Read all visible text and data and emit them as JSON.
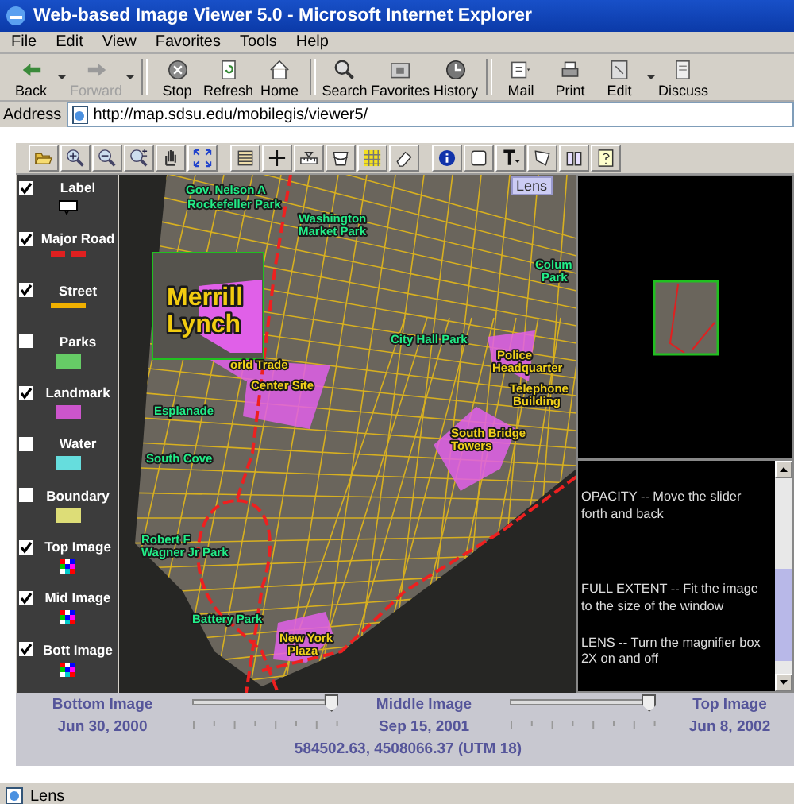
{
  "window": {
    "title": "Web-based Image Viewer 5.0 - Microsoft Internet Explorer"
  },
  "menu": [
    "File",
    "Edit",
    "View",
    "Favorites",
    "Tools",
    "Help"
  ],
  "toolbar": [
    {
      "label": "Back",
      "kind": "back",
      "disabled": false,
      "dropdown": true
    },
    {
      "label": "Forward",
      "kind": "forward",
      "disabled": true,
      "dropdown": true
    },
    {
      "label": "Stop",
      "kind": "stop",
      "disabled": false,
      "dropdown": false
    },
    {
      "label": "Refresh",
      "kind": "refresh",
      "disabled": false,
      "dropdown": false
    },
    {
      "label": "Home",
      "kind": "home",
      "disabled": false,
      "dropdown": false
    },
    {
      "label": "Search",
      "kind": "search",
      "disabled": false,
      "dropdown": false
    },
    {
      "label": "Favorites",
      "kind": "favorites",
      "disabled": false,
      "dropdown": false
    },
    {
      "label": "History",
      "kind": "history",
      "disabled": false,
      "dropdown": false
    },
    {
      "label": "Mail",
      "kind": "mail",
      "disabled": false,
      "dropdown": false
    },
    {
      "label": "Print",
      "kind": "print",
      "disabled": false,
      "dropdown": false
    },
    {
      "label": "Edit",
      "kind": "edit",
      "disabled": false,
      "dropdown": true
    },
    {
      "label": "Discuss",
      "kind": "discuss",
      "disabled": false,
      "dropdown": false
    }
  ],
  "address": {
    "label": "Address",
    "value": "http://map.sdsu.edu/mobilegis/viewer5/"
  },
  "legend": [
    {
      "label": "Label",
      "checked": true,
      "kind": "label"
    },
    {
      "label": "Major Road",
      "checked": true,
      "kind": "dash"
    },
    {
      "label": "Street",
      "checked": true,
      "kind": "line"
    },
    {
      "label": "Parks",
      "checked": false,
      "kind": "swatch",
      "color": "#66cc66"
    },
    {
      "label": "Landmark",
      "checked": true,
      "kind": "swatch",
      "color": "#cc55cc"
    },
    {
      "label": "Water",
      "checked": false,
      "kind": "swatch",
      "color": "#66dddd"
    },
    {
      "label": "Boundary",
      "checked": false,
      "kind": "swatch",
      "color": "#dddd77"
    },
    {
      "label": "Top Image",
      "checked": true,
      "kind": "image"
    },
    {
      "label": "Mid Image",
      "checked": true,
      "kind": "image"
    },
    {
      "label": "Bott Image",
      "checked": true,
      "kind": "image"
    }
  ],
  "map": {
    "lens_button": "Lens",
    "labels": [
      {
        "kind": "park",
        "lines": [
          "Gov. Nelson A",
          "Rockefeller Park"
        ]
      },
      {
        "kind": "park",
        "lines": [
          "Washington",
          "Market Park"
        ]
      },
      {
        "kind": "featured",
        "lines": [
          "Merrill",
          "Lynch"
        ]
      },
      {
        "kind": "landmark",
        "lines": [
          "orld Trade",
          "Center Site"
        ]
      },
      {
        "kind": "park",
        "lines": [
          "Colum",
          "Park"
        ]
      },
      {
        "kind": "park",
        "lines": [
          "City Hall Park"
        ]
      },
      {
        "kind": "landmark",
        "lines": [
          "Police",
          "Headquarter"
        ]
      },
      {
        "kind": "landmark",
        "lines": [
          "Telephone",
          "Building"
        ]
      },
      {
        "kind": "park",
        "lines": [
          "Esplanade"
        ]
      },
      {
        "kind": "landmark",
        "lines": [
          "South Bridge",
          "Towers"
        ]
      },
      {
        "kind": "park",
        "lines": [
          "South Cove"
        ]
      },
      {
        "kind": "park",
        "lines": [
          "Robert F",
          "Wagner Jr Park"
        ]
      },
      {
        "kind": "park",
        "lines": [
          "Battery Park"
        ]
      },
      {
        "kind": "landmark",
        "lines": [
          "New York",
          "Plaza"
        ]
      }
    ]
  },
  "help_text": [
    "OPACITY -- Move the slider forth and back",
    "FULL EXTENT -- Fit the image to the size of the window",
    "LENS -- Turn the magnifier box 2X on and off"
  ],
  "layers": [
    {
      "title": "Bottom Image",
      "date": "Jun 30, 2000"
    },
    {
      "title": "Middle Image",
      "date": "Sep 15, 2001"
    },
    {
      "title": "Top Image",
      "date": "Jun 8, 2002"
    }
  ],
  "sliders": [
    {
      "level": 0.95
    },
    {
      "level": 0.95
    }
  ],
  "coordinates": "584502.63, 4508066.37  (UTM 18)",
  "status_bar": {
    "text": "Lens"
  }
}
